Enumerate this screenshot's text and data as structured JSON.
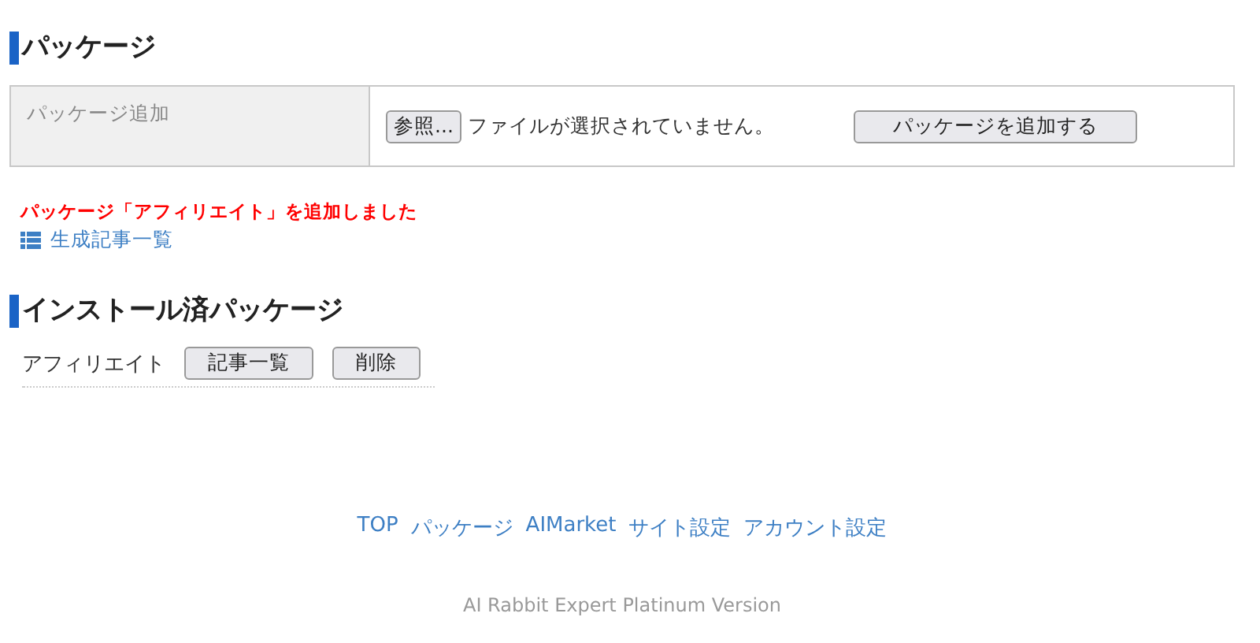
{
  "sections": [
    {
      "title": "パッケージ"
    },
    {
      "title": "インストール済パッケージ"
    }
  ],
  "add_form": {
    "label": "パッケージ追加",
    "browse_button": "参照...",
    "file_status": "ファイルが選択されていません。",
    "submit_button": "パッケージを追加する"
  },
  "message": "パッケージ「アフィリエイト」を追加しました",
  "articles_link": "生成記事一覧",
  "installed": [
    {
      "name": "アフィリエイト",
      "buttons": [
        "記事一覧",
        "削除"
      ]
    }
  ],
  "footer_links": [
    "TOP",
    "パッケージ",
    "AIMarket",
    "サイト設定",
    "アカウント設定"
  ],
  "version": "AI Rabbit Expert Platinum Version"
}
